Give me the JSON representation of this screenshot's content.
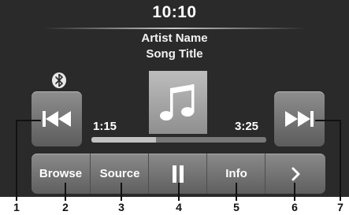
{
  "clock": "10:10",
  "now_playing": {
    "artist": "Artist Name",
    "song": "Song Title",
    "elapsed": "1:15",
    "total": "3:25",
    "progress_fraction": 0.37
  },
  "icons": {
    "bluetooth": "bluetooth-icon",
    "previous": "previous-track-icon",
    "next": "next-track-icon",
    "album_art": "music-note-icon",
    "pause": "pause-icon",
    "more": "chevron-right-icon"
  },
  "bottom_bar": {
    "browse": "Browse",
    "source": "Source",
    "info": "Info"
  },
  "callouts": [
    "1",
    "2",
    "3",
    "4",
    "5",
    "6",
    "7"
  ],
  "colors": {
    "screen_background": "#2a2a2a",
    "button_face": "#7a7a7a",
    "text": "#ffffff"
  }
}
